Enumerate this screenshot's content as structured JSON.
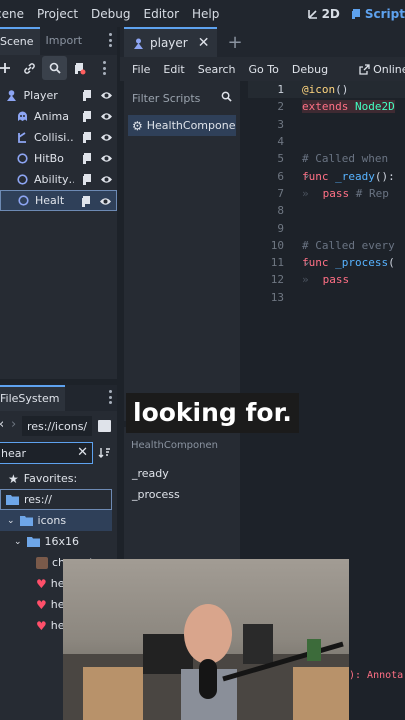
{
  "menubar": {
    "items": [
      "cene",
      "Project",
      "Debug",
      "Editor",
      "Help"
    ],
    "workspaces": [
      {
        "label": "2D",
        "active": false
      },
      {
        "label": "Script",
        "active": true
      }
    ]
  },
  "scene_dock": {
    "tabs": [
      {
        "label": "Scene",
        "active": true
      },
      {
        "label": "Import",
        "active": false
      }
    ],
    "tree": [
      {
        "label": "Player",
        "icon": "character-node-icon",
        "icon_color": "#8da5f3",
        "indent": 1,
        "selected": false
      },
      {
        "label": "Anima",
        "icon": "animated-sprite-icon",
        "icon_color": "#8da5f3",
        "indent": 2,
        "selected": false
      },
      {
        "label": "Collisi…",
        "icon": "collision-shape-icon",
        "icon_color": "#8da5f3",
        "indent": 2,
        "selected": false
      },
      {
        "label": "HitBo",
        "icon": "node-circle-icon",
        "icon_color": "#8da5f3",
        "indent": 2,
        "selected": false
      },
      {
        "label": "Ability…",
        "icon": "node-circle-icon",
        "icon_color": "#8da5f3",
        "indent": 2,
        "selected": false
      },
      {
        "label": "Healt",
        "icon": "node-circle-icon",
        "icon_color": "#8da5f3",
        "indent": 2,
        "selected": true
      }
    ]
  },
  "editor": {
    "tab": "player",
    "menu": [
      "File",
      "Edit",
      "Search",
      "Go To",
      "Debug"
    ],
    "online_label": "Online D",
    "filter_placeholder": "Filter Scripts",
    "script_item": "HealthCompone…",
    "methods_filter": "HealthComponen",
    "methods": [
      "_ready",
      "_process"
    ],
    "code_lines": [
      {
        "n": "1",
        "text": "@icon()"
      },
      {
        "n": "2",
        "text": "extends Node2D"
      },
      {
        "n": "3",
        "text": ""
      },
      {
        "n": "4",
        "text": ""
      },
      {
        "n": "5",
        "text": "# Called when"
      },
      {
        "n": "6",
        "text": "func _ready():"
      },
      {
        "n": "7",
        "text": "pass # Rep"
      },
      {
        "n": "8",
        "text": ""
      },
      {
        "n": "9",
        "text": ""
      },
      {
        "n": "10",
        "text": "# Called every"
      },
      {
        "n": "11",
        "text": "func _process("
      },
      {
        "n": "12",
        "text": "pass"
      },
      {
        "n": "13",
        "text": ""
      }
    ],
    "bottom_error": "): Annota"
  },
  "filesystem": {
    "tab": "FileSystem",
    "path": "res://icons/",
    "search_value": "hear",
    "favorites_label": "Favorites:",
    "items": [
      {
        "label": "res://",
        "type": "folder"
      },
      {
        "label": "icons",
        "type": "folder"
      },
      {
        "label": "16x16",
        "type": "folder"
      },
      {
        "label": "character",
        "type": "file"
      },
      {
        "label": "he",
        "type": "file"
      },
      {
        "label": "he",
        "type": "file"
      },
      {
        "label": "he",
        "type": "file"
      }
    ]
  },
  "caption": "looking for.",
  "colors": {
    "accent": "#5ea2ef",
    "keyword": "#ff7085",
    "annotation": "#fdd47e",
    "type": "#42ffc2",
    "function": "#57b3ff",
    "comment": "#6a7483"
  }
}
